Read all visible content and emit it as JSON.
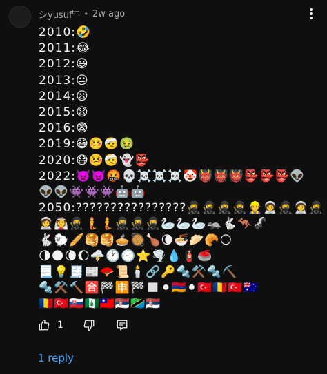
{
  "comment": {
    "username": "シyusuf",
    "username_sup": "tm",
    "separator": "•",
    "timestamp": "2w ago",
    "lines": [
      "2010:🤣",
      "2011:😂",
      "2012:😃",
      "2013:😐",
      "2014:😦",
      "2015:😧",
      "2016:😨",
      "2019:😷🤒🤕🤢",
      "2020:😷🤒🤕👻👺",
      "2022:👿👿🤬💀☠️☠️☠️🤡👹👹👹👺👺👺👽",
      "👽👽👾👾👾🤖🤖",
      "2050:????????????????🥷🥷🥷🥷👷🧑‍🚀🥷🧑‍🚀🥷",
      "🧑‍🚀👰🥷🧜🧜🥷🥷🥷🦢🦢🦢🦡🐇🦘🦨",
      "🐇🐑🥖🥞🥞🥧🥘🍗🌘🍜🥟🥐🌕",
      "🌗🌑🌘🌔🌩️🕐🕘⭐🌪️💧🧯🥌",
      "📃💡🧾📰🪭📜🕯️🔗🔑🔩⚒️🔩⛏️",
      "🔩⚒️🔨🈴🏁🈸🏁◻️⚫🇦🇲⚫🇹🇷🇷🇴🇹🇷🇦🇺",
      "🇷🇴🇹🇷🇸🇰🇳🇫🇹🇼🇷🇸🇹🇿🇷🇸"
    ]
  },
  "actions": {
    "like_count": "1",
    "like_icon": "thumbs-up-icon",
    "dislike_icon": "thumbs-down-icon",
    "reply_icon": "comment-reply-icon"
  },
  "replies_label": "1 reply"
}
